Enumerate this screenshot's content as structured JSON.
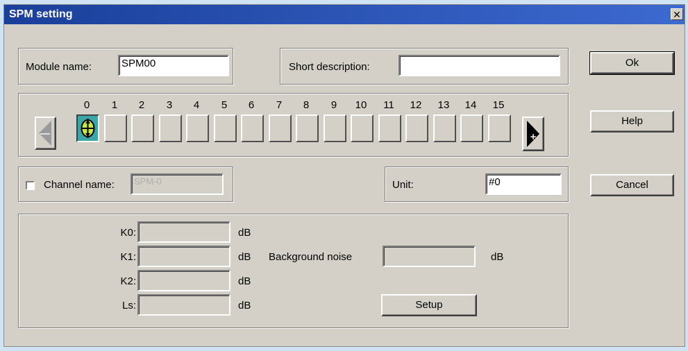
{
  "window": {
    "title": "SPM setting",
    "close_label": "✕"
  },
  "module": {
    "name_label": "Module name:",
    "name_value": "SPM00",
    "desc_label": "Short description:",
    "desc_value": ""
  },
  "buttons": {
    "ok": "Ok",
    "help": "Help",
    "cancel": "Cancel",
    "setup": "Setup"
  },
  "channels": {
    "numbers": [
      "0",
      "1",
      "2",
      "3",
      "4",
      "5",
      "6",
      "7",
      "8",
      "9",
      "10",
      "11",
      "12",
      "13",
      "14",
      "15"
    ],
    "selected": "0",
    "prev_icon": "arrow-left-icon",
    "next_icon": "arrow-right-icon",
    "active_icon": "sensor-icon"
  },
  "channel": {
    "checkbox_label": "Channel name:",
    "name_value": "SPM-0",
    "checked": false,
    "unit_label": "Unit:",
    "unit_value": "#0"
  },
  "calibration": {
    "rows": [
      {
        "label": "K0:",
        "value": "",
        "unit": "dB"
      },
      {
        "label": "K1:",
        "value": "",
        "unit": "dB"
      },
      {
        "label": "K2:",
        "value": "",
        "unit": "dB"
      },
      {
        "label": "Ls:",
        "value": "",
        "unit": "dB"
      }
    ],
    "bg_label": "Background noise",
    "bg_value": "",
    "bg_unit": "dB"
  }
}
